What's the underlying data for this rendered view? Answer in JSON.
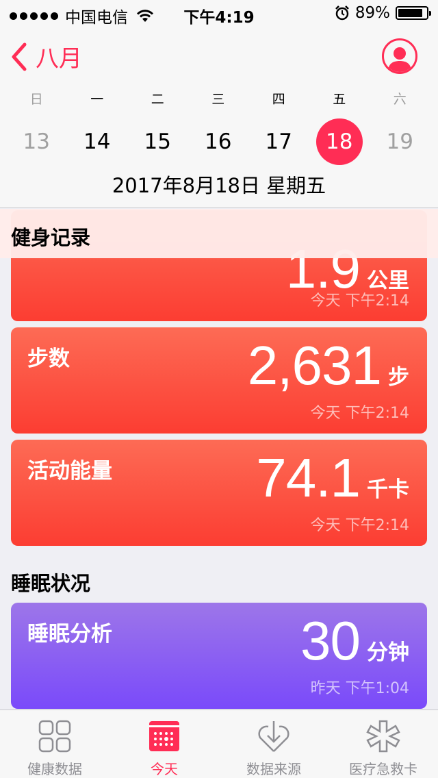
{
  "status_bar": {
    "carrier": "中国电信",
    "time": "下午4:19",
    "battery": "89%"
  },
  "header": {
    "back_label": "八月",
    "weekdays": [
      "日",
      "一",
      "二",
      "三",
      "四",
      "五",
      "六"
    ],
    "dates": [
      "13",
      "14",
      "15",
      "16",
      "17",
      "18",
      "19"
    ],
    "selected_index": 5,
    "full_date": "2017年8月18日 星期五"
  },
  "fitness": {
    "title": "健身记录",
    "cards": [
      {
        "label": "",
        "value": "1.9",
        "unit": "公里",
        "time": "今天 下午2:14"
      },
      {
        "label": "步数",
        "value": "2,631",
        "unit": "步",
        "time": "今天 下午2:14"
      },
      {
        "label": "活动能量",
        "value": "74.1",
        "unit": "千卡",
        "time": "今天 下午2:14"
      }
    ]
  },
  "sleep": {
    "title": "睡眠状况",
    "card": {
      "label": "睡眠分析",
      "value": "30",
      "unit": "分钟",
      "time": "昨天 下午1:04"
    }
  },
  "tabs": [
    {
      "label": "健康数据",
      "icon": "grid-icon"
    },
    {
      "label": "今天",
      "icon": "calendar-icon"
    },
    {
      "label": "数据来源",
      "icon": "download-heart-icon"
    },
    {
      "label": "医疗急救卡",
      "icon": "medical-star-icon"
    }
  ],
  "colors": {
    "accent": "#ff2d55",
    "card_red": "#fc3d32",
    "card_purple": "#7a4afa"
  }
}
